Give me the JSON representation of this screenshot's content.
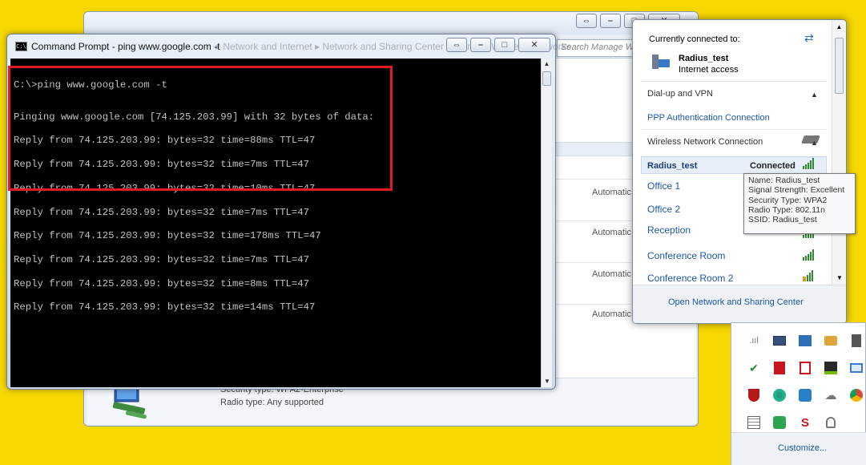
{
  "background_window": {
    "search_placeholder": "Search Manage Wi",
    "rows": [
      {
        "connect": "Automatic"
      },
      {
        "connect": "Automatic"
      },
      {
        "connect": "Automatic"
      },
      {
        "connect": "Automatic"
      }
    ],
    "details": {
      "security_type": "Security type: WPA2-Enterprise",
      "radio_type": "Radio type: Any supported"
    }
  },
  "cmd": {
    "title": "Command Prompt - ping  www.google.com -t",
    "title_behind": "▸ Network and Internet ▸ Network and Sharing Center ▸ Manage Wireless Networks",
    "prompt": "C:\\>ping www.google.com -t",
    "lines": [
      "Pinging www.google.com [74.125.203.99] with 32 bytes of data:",
      "Reply from 74.125.203.99: bytes=32 time=88ms TTL=47",
      "Reply from 74.125.203.99: bytes=32 time=7ms TTL=47",
      "Reply from 74.125.203.99: bytes=32 time=10ms TTL=47",
      "Reply from 74.125.203.99: bytes=32 time=7ms TTL=47",
      "Reply from 74.125.203.99: bytes=32 time=178ms TTL=47",
      "Reply from 74.125.203.99: bytes=32 time=7ms TTL=47",
      "Reply from 74.125.203.99: bytes=32 time=8ms TTL=47",
      "Reply from 74.125.203.99: bytes=32 time=14ms TTL=47"
    ],
    "highlight_color": "#e21b23"
  },
  "flyout": {
    "currently_connected_label": "Currently connected to:",
    "current_network": "Radius_test",
    "current_status": "Internet access",
    "dialup_section": "Dial-up and VPN",
    "ppp_connection": "PPP Authentication Connection",
    "wireless_section": "Wireless Network Connection",
    "networks": [
      {
        "name": "Radius_test",
        "status": "Connected"
      },
      {
        "name": "Office 1"
      },
      {
        "name": "Office 2"
      },
      {
        "name": "Reception"
      },
      {
        "name": "Conference Room"
      },
      {
        "name": "Conference Room 2"
      }
    ],
    "footer_link": "Open Network and Sharing Center"
  },
  "tooltip": {
    "name": "Name: Radius_test",
    "signal": "Signal Strength: Excellent",
    "security": "Security Type: WPA2",
    "radio": "Radio Type: 802.11n",
    "ssid": "SSID: Radius_test"
  },
  "tray": {
    "icons": [
      "network-bars-icon",
      "monitor-icon",
      "display-icon",
      "folder-icon",
      "device-icon",
      "shield-check-icon",
      "pdf-icon",
      "pdf-reader-icon",
      "nvidia-icon",
      "window-icon",
      "mcafee-icon",
      "chrome-icon",
      "remote-icon",
      "cloud-icon",
      "chrome-color-icon",
      "grid-icon",
      "messenger-icon",
      "sync-icon",
      "gpu-icon"
    ],
    "customize_label": "Customize..."
  }
}
